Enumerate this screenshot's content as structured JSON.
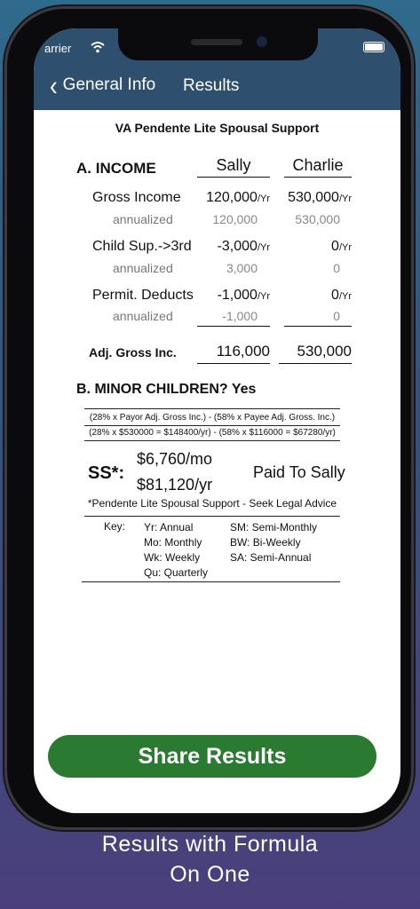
{
  "status": {
    "carrier": "arrier"
  },
  "nav": {
    "back_label": "General Info",
    "title": "Results"
  },
  "doc_title": "VA Pendente Lite Spousal Support",
  "income": {
    "heading": "A. INCOME",
    "col1": "Sally",
    "col2": "Charlie",
    "rows": [
      {
        "label": "Gross Income",
        "v1": "120,000",
        "u1": "/Yr",
        "v2": "530,000",
        "u2": "/Yr",
        "ann_label": "annualized",
        "a1": "120,000",
        "a2": "530,000"
      },
      {
        "label": "Child Sup.->3rd",
        "v1": "-3,000",
        "u1": "/Yr",
        "v2": "0",
        "u2": "/Yr",
        "ann_label": "annualized",
        "a1": "3,000",
        "a2": "0"
      },
      {
        "label": "Permit. Deducts",
        "v1": "-1,000",
        "u1": "/Yr",
        "v2": "0",
        "u2": "/Yr",
        "ann_label": "annualized",
        "a1": "-1,000",
        "a2": "0"
      }
    ],
    "adj_label": "Adj. Gross Inc.",
    "adj1": "116,000",
    "adj2": "530,000"
  },
  "children": {
    "heading": "B. MINOR CHILDREN? Yes"
  },
  "formula": {
    "line1": "(28% x Payor Adj. Gross Inc.) - (58% x Payee Adj. Gross. Inc.)",
    "line2": "(28% x $530000 = $148400/yr) - (58% x $116000 = $67280/yr)"
  },
  "support": {
    "label": "SS*:",
    "monthly": "$6,760/mo",
    "yearly": "$81,120/yr",
    "paid_to": "Paid To Sally",
    "note": "*Pendente Lite Spousal Support - Seek Legal Advice"
  },
  "key": {
    "title": "Key:",
    "col1": [
      "Yr: Annual",
      "Mo: Monthly",
      "Wk: Weekly",
      "Qu: Quarterly"
    ],
    "col2": [
      "SM: Semi-Monthly",
      "BW: Bi-Weekly",
      "SA: Semi-Annual"
    ]
  },
  "share_button": "Share Results",
  "caption": {
    "line1": "Results with Formula",
    "line2": "On One"
  },
  "colors": {
    "nav_bg": "#2e4f6e",
    "share_green": "#2a7a31"
  }
}
